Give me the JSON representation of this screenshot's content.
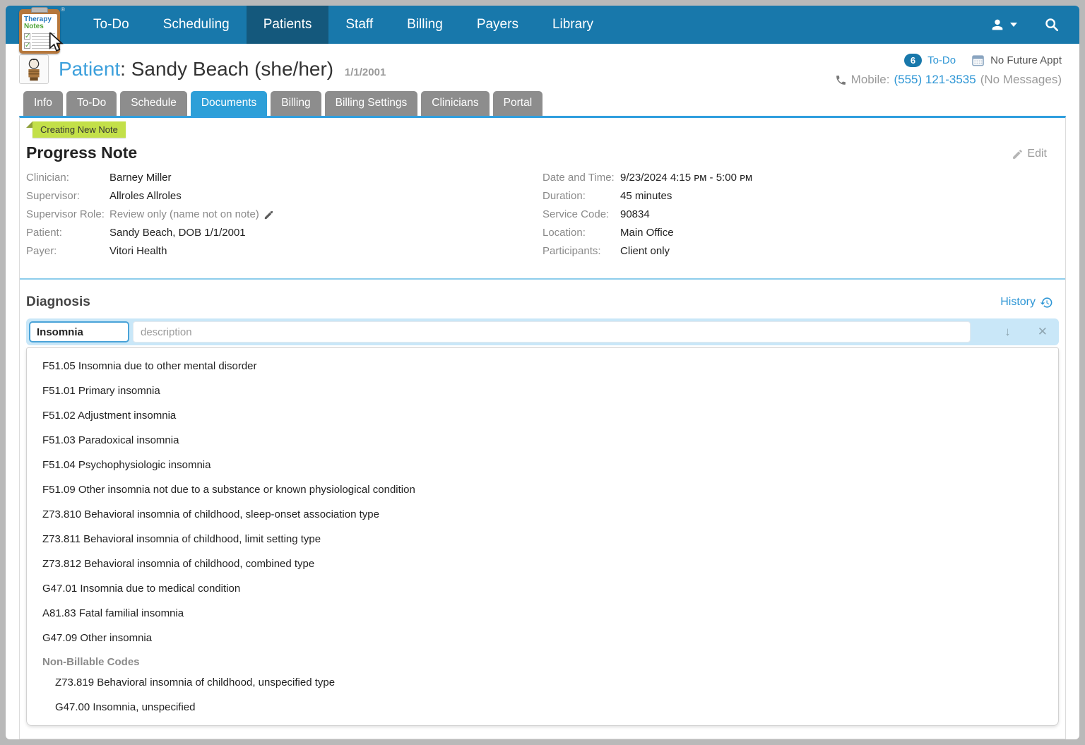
{
  "brand": {
    "line1": "Therapy",
    "line2": "Notes",
    "registered": "®"
  },
  "nav": {
    "items": [
      {
        "label": "To-Do"
      },
      {
        "label": "Scheduling"
      },
      {
        "label": "Patients",
        "active": true
      },
      {
        "label": "Staff"
      },
      {
        "label": "Billing"
      },
      {
        "label": "Payers"
      },
      {
        "label": "Library"
      }
    ]
  },
  "icons": {
    "user": "user-icon",
    "search": "search-icon",
    "calendar": "calendar-icon",
    "phone": "phone-icon",
    "edit": "pencil-icon",
    "history": "history-clock-icon",
    "supervisor_readonly": "pencil-slash-icon",
    "move": "↓",
    "remove": "✕"
  },
  "patient_header": {
    "label": "Patient",
    "colon": ":",
    "name": "Sandy Beach (she/her)",
    "dob": "1/1/2001",
    "todo_count": "6",
    "todo_label": "To-Do",
    "appt_status": "No Future Appt",
    "mobile_label": "Mobile:",
    "mobile_number": "(555) 121-3535",
    "mobile_note": "(No Messages)"
  },
  "tabs": [
    {
      "label": "Info"
    },
    {
      "label": "To-Do"
    },
    {
      "label": "Schedule"
    },
    {
      "label": "Documents",
      "active": true
    },
    {
      "label": "Billing"
    },
    {
      "label": "Billing Settings"
    },
    {
      "label": "Clinicians"
    },
    {
      "label": "Portal"
    }
  ],
  "note": {
    "ribbon": "Creating New Note",
    "title": "Progress Note",
    "edit_label": "Edit",
    "fields_left": [
      {
        "label": "Clinician:",
        "value": "Barney Miller"
      },
      {
        "label": "Supervisor:",
        "value": "Allroles Allroles"
      },
      {
        "label": "Supervisor Role:",
        "value": "Review only (name not on note)"
      },
      {
        "label": "Patient:",
        "value": "Sandy Beach, DOB 1/1/2001"
      },
      {
        "label": "Payer:",
        "value": "Vitori Health"
      }
    ],
    "fields_right": [
      {
        "label": "Date and Time:",
        "value": "9/23/2024 4:15 ᴘᴍ - 5:00 ᴘᴍ"
      },
      {
        "label": "Duration:",
        "value": "45 minutes"
      },
      {
        "label": "Service Code:",
        "value": "90834"
      },
      {
        "label": "Location:",
        "value": "Main Office"
      },
      {
        "label": "Participants:",
        "value": "Client only"
      }
    ]
  },
  "diagnosis": {
    "title": "Diagnosis",
    "history_label": "History",
    "code_value": "Insomnia",
    "description_placeholder": "description",
    "move_icon": "↓",
    "remove_icon": "✕",
    "dropdown": {
      "billable": [
        "F51.05 Insomnia due to other mental disorder",
        "F51.01 Primary insomnia",
        "F51.02 Adjustment insomnia",
        "F51.03 Paradoxical insomnia",
        "F51.04 Psychophysiologic insomnia",
        "F51.09 Other insomnia not due to a substance or known physiological condition",
        "Z73.810 Behavioral insomnia of childhood, sleep-onset association type",
        "Z73.811 Behavioral insomnia of childhood, limit setting type",
        "Z73.812 Behavioral insomnia of childhood, combined type",
        "G47.01 Insomnia due to medical condition",
        "A81.83 Fatal familial insomnia",
        "G47.09 Other insomnia"
      ],
      "non_billable_header": "Non-Billable Codes",
      "non_billable": [
        "Z73.819 Behavioral insomnia of childhood, unspecified type",
        "G47.00 Insomnia, unspecified"
      ]
    }
  },
  "colors": {
    "nav_bg": "#1878ab",
    "nav_active_bg": "#14587c",
    "tab_active": "#2d9fd8",
    "tab_inactive": "#8d8d8d",
    "link": "#2e96d5",
    "ribbon_bg": "#c3e049",
    "diagnosis_row_bg": "#c9e7f8",
    "badge_bg": "#1878ab"
  }
}
